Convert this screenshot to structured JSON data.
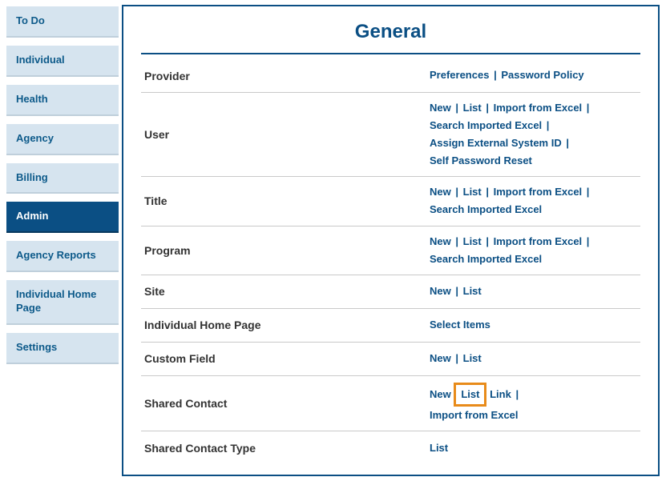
{
  "sidebar": {
    "items": [
      {
        "label": "To Do"
      },
      {
        "label": "Individual"
      },
      {
        "label": "Health"
      },
      {
        "label": "Agency"
      },
      {
        "label": "Billing"
      },
      {
        "label": "Admin"
      },
      {
        "label": "Agency Reports"
      },
      {
        "label": "Individual Home Page"
      },
      {
        "label": "Settings"
      }
    ],
    "active_index": 5
  },
  "page": {
    "title": "General"
  },
  "rows": {
    "provider": {
      "label": "Provider",
      "links": {
        "preferences": "Preferences",
        "password_policy": "Password Policy"
      }
    },
    "user": {
      "label": "User",
      "links": {
        "new": "New",
        "list": "List",
        "import": "Import from Excel",
        "search_imported": "Search Imported Excel",
        "assign_ext": "Assign External System ID",
        "self_pw": "Self Password Reset"
      }
    },
    "title_section": {
      "label": "Title",
      "links": {
        "new": "New",
        "list": "List",
        "import": "Import from Excel",
        "search_imported": "Search Imported Excel"
      }
    },
    "program": {
      "label": "Program",
      "links": {
        "new": "New",
        "list": "List",
        "import": "Import from Excel",
        "search_imported": "Search Imported Excel"
      }
    },
    "site": {
      "label": "Site",
      "links": {
        "new": "New",
        "list": "List"
      }
    },
    "ind_home": {
      "label": "Individual Home Page",
      "links": {
        "select_items": "Select Items"
      }
    },
    "custom_field": {
      "label": "Custom Field",
      "links": {
        "new": "New",
        "list": "List"
      }
    },
    "shared_contact": {
      "label": "Shared Contact",
      "links": {
        "new": "New",
        "list": "List",
        "link": "Link",
        "import": "Import from Excel"
      }
    },
    "shared_contact_type": {
      "label": "Shared Contact Type",
      "links": {
        "list": "List"
      }
    }
  },
  "separator": "|"
}
